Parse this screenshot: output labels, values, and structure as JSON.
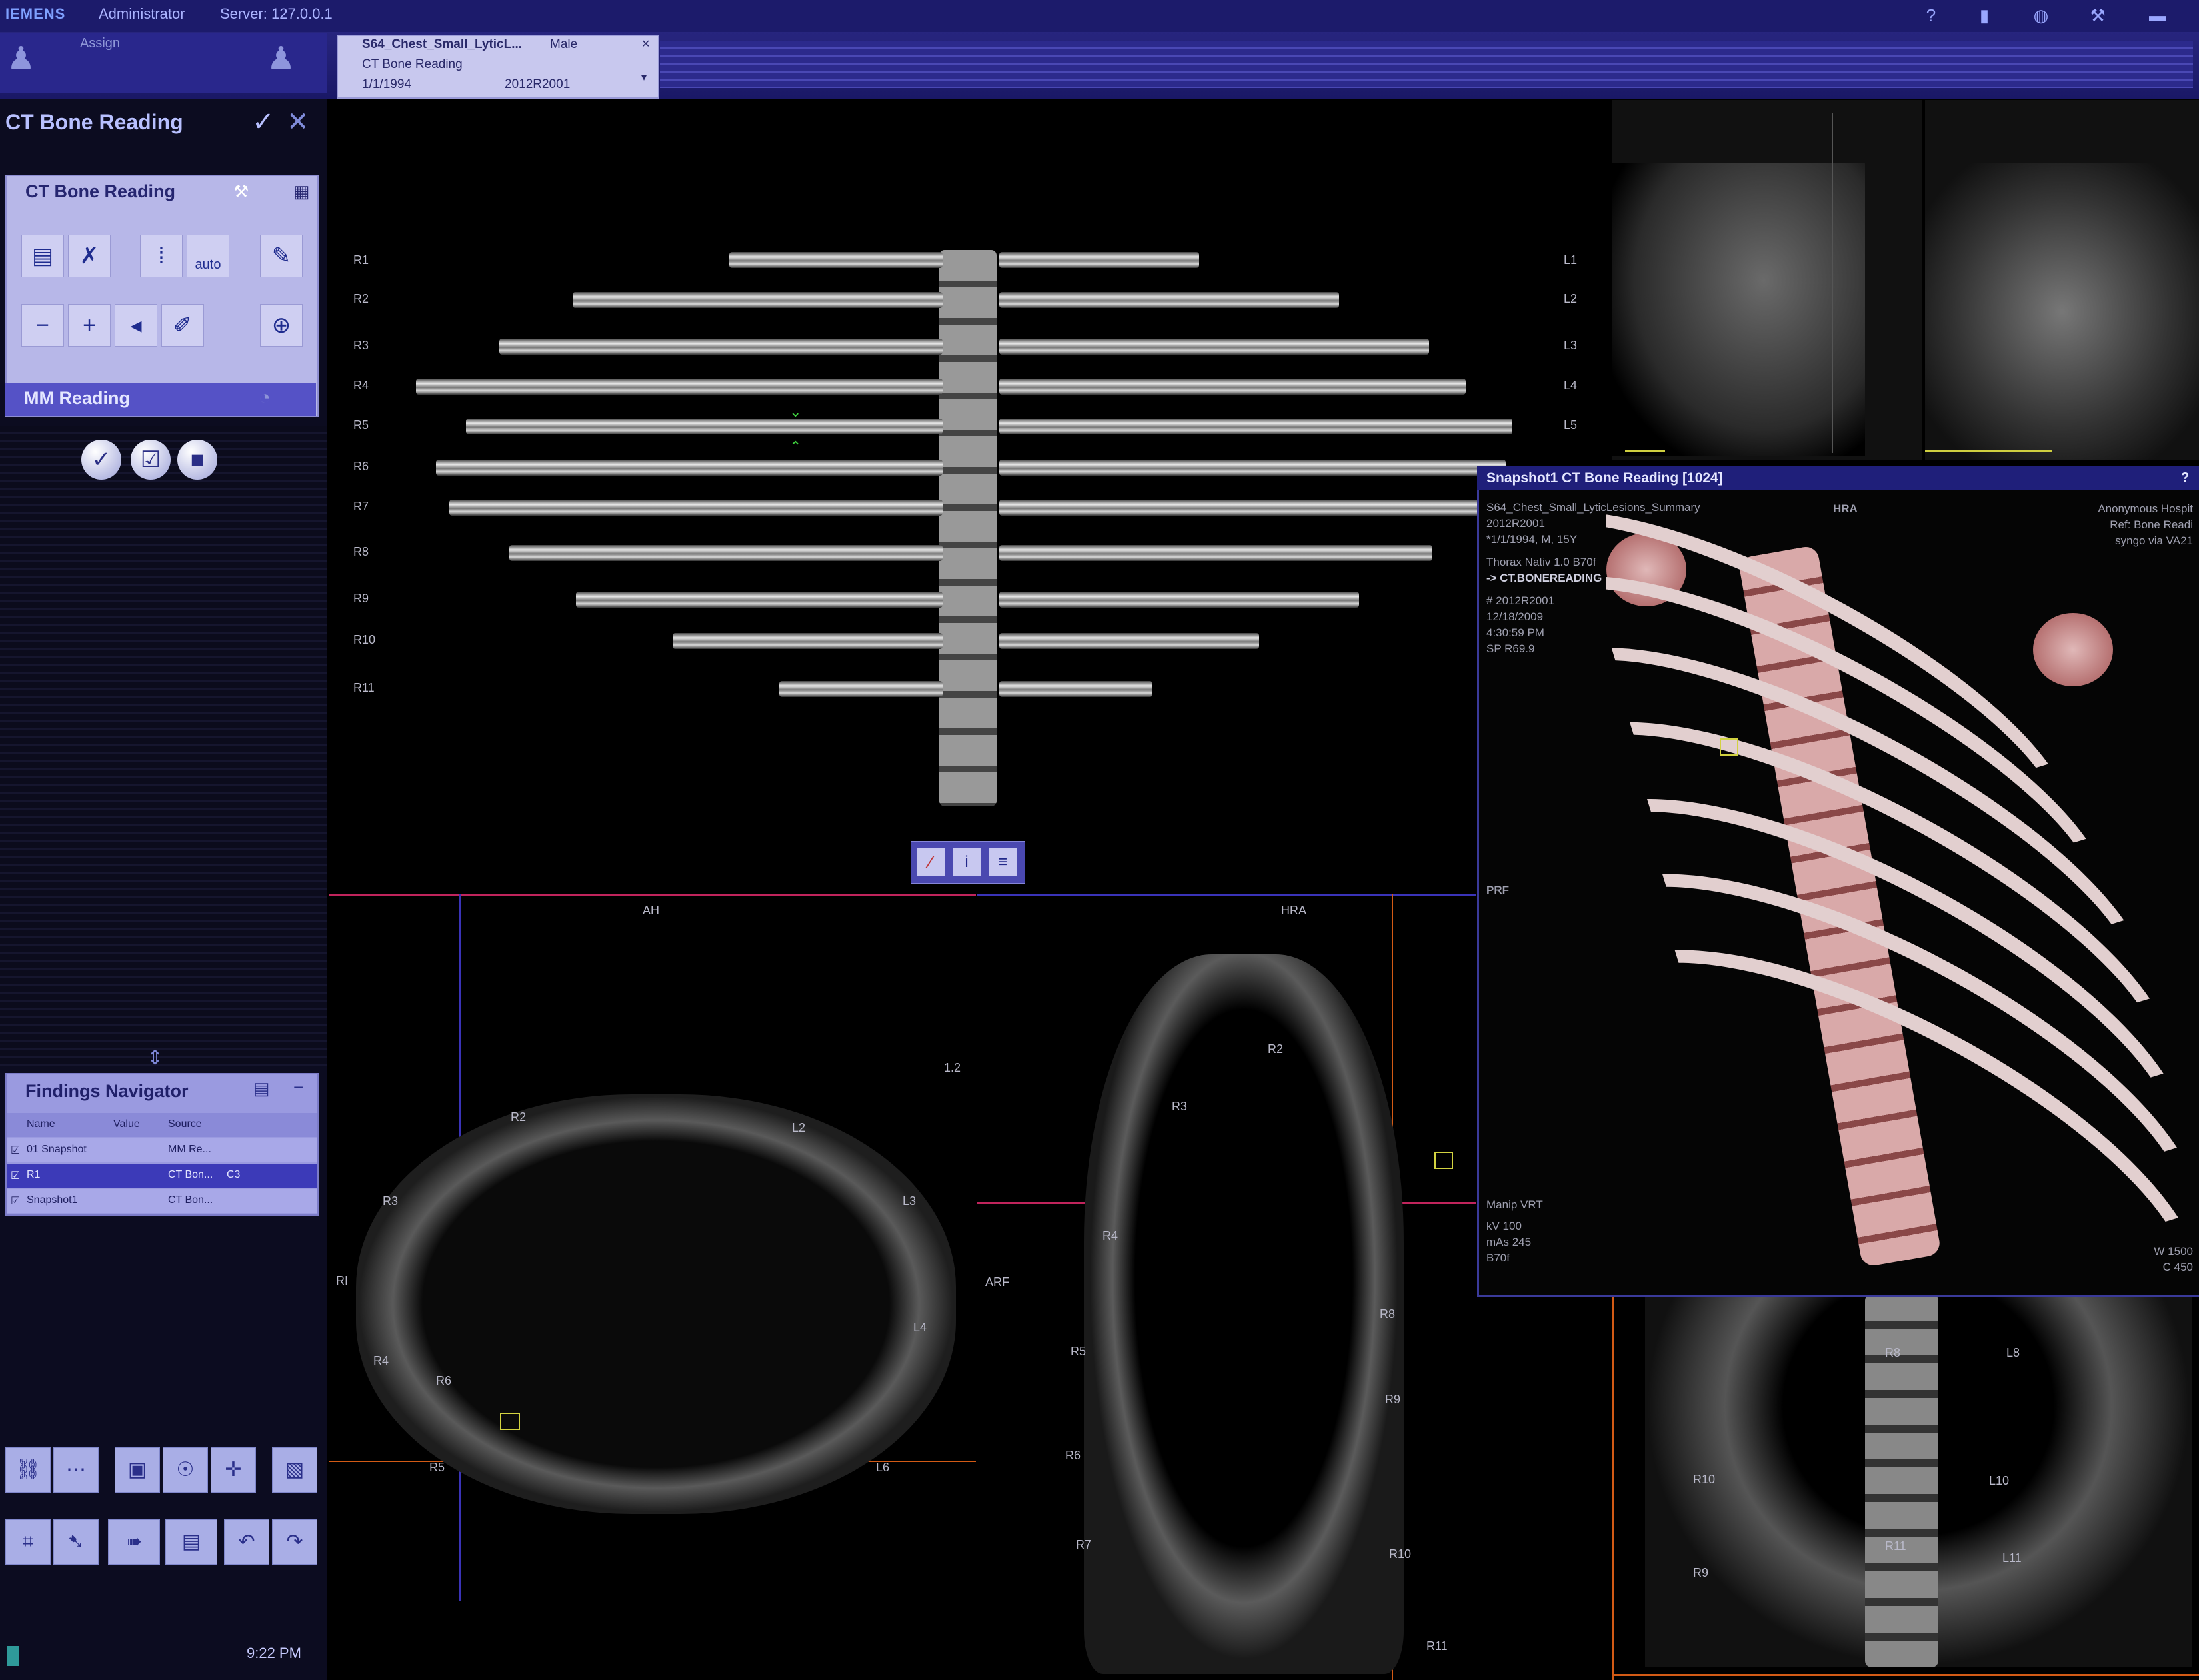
{
  "topbar": {
    "brand": "IEMENS",
    "user": "Administrator",
    "server": "Server: 127.0.0.1",
    "icons": [
      "help-icon",
      "save-icon",
      "globe-icon",
      "wrench-icon",
      "window-icon"
    ]
  },
  "assign": {
    "label": "Assign"
  },
  "patient_tab": {
    "name": "S64_Chest_Small_LyticL...",
    "sex": "Male",
    "workflow": "CT Bone Reading",
    "dob": "1/1/1994",
    "id": "2012R2001"
  },
  "left_panel": {
    "workflow_title": "CT Bone Reading",
    "ct_panel_title": "CT Bone Reading",
    "auto_label": "auto",
    "mm_reading": "MM Reading",
    "findings": {
      "title": "Findings Navigator",
      "columns": [
        "Name",
        "Value",
        "Source"
      ],
      "rows": [
        {
          "name": "01 Snapshot",
          "source": "MM Re...",
          "value": ""
        },
        {
          "name": "R1",
          "source": "CT Bon...",
          "value": "C3"
        },
        {
          "name": "Snapshot1",
          "source": "CT Bon...",
          "value": ""
        }
      ]
    },
    "clock": "9:22 PM"
  },
  "rib_view": {
    "left_labels": [
      "R1",
      "R2",
      "R3",
      "R4",
      "R5",
      "R6",
      "R7",
      "R8",
      "R9",
      "R10",
      "R11"
    ],
    "right_labels": [
      "L1",
      "L2",
      "L3",
      "L4",
      "L5"
    ]
  },
  "axial_view": {
    "top": "AH",
    "left": "RI",
    "scale": "1.2",
    "labels": [
      "R2",
      "L2",
      "R3",
      "L3",
      "R4",
      "L4",
      "R5",
      "R6",
      "L6"
    ]
  },
  "sagittal_view": {
    "top": "HRA",
    "left": "ARF",
    "labels": [
      "R2",
      "R3",
      "R4",
      "R5",
      "R6",
      "R7",
      "R8",
      "R9",
      "R10",
      "R11"
    ]
  },
  "coronal_view": {
    "labels": [
      "R8",
      "L8",
      "L10",
      "L11",
      "R10",
      "R11",
      "R9"
    ]
  },
  "snapshot": {
    "title": "Snapshot1 CT Bone Reading [1024]",
    "help": "?",
    "info_left": [
      "S64_Chest_Small_LyticLesions_Summary",
      "2012R2001",
      "*1/1/1994, M, 15Y",
      "Thorax Nativ 1.0 B70f",
      "-> CT.BONEREADING",
      "# 2012R2001",
      "12/18/2009",
      "4:30:59 PM",
      "SP R69.9"
    ],
    "top_center": "HRA",
    "info_right": [
      "Anonymous Hospit",
      "Ref: Bone Readi",
      "syngo via VA21"
    ],
    "left_side": "PRF",
    "bottom_left": [
      "Manip VRT",
      "kV 100",
      "mAs 245",
      "B70f"
    ],
    "bottom_right": [
      "W 1500",
      "C 450"
    ]
  }
}
